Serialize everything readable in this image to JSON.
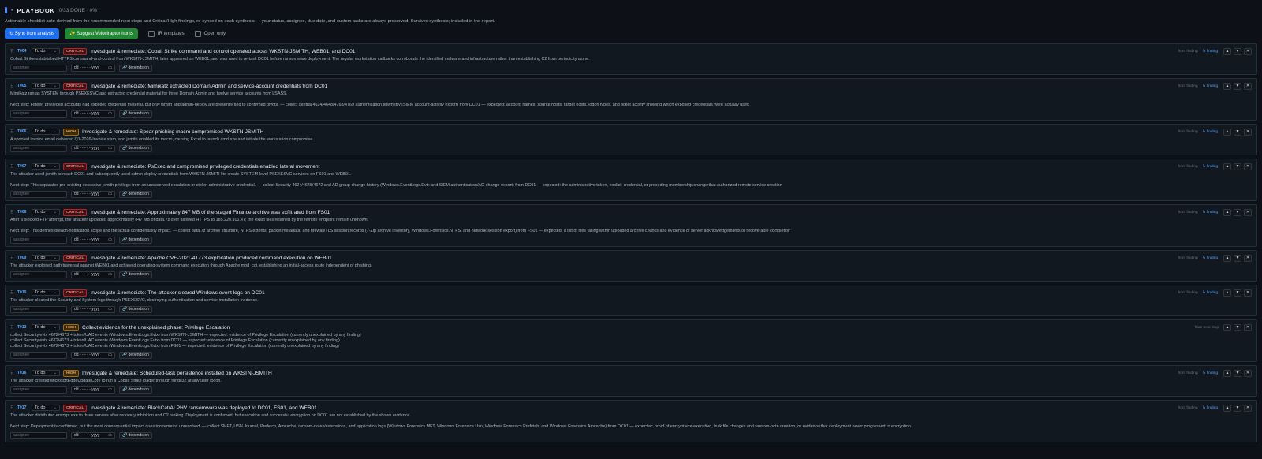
{
  "header": {
    "title": "PLAYBOOK",
    "count": "0/33 DONE · 0%"
  },
  "description": "Actionable checklist auto-derived from the recommended next steps and Critical/High findings, re-synced on each synthesis — your status, assignee, due date, and custom tasks are always preserved. Survives synthesis; included in the report.",
  "toolbar": {
    "sync_label": "↻ Sync from analysis",
    "suggest_label": "✨ Suggest Velociraptor hunts",
    "ir_templates_label": "IR templates",
    "open_only_label": "Open only"
  },
  "common": {
    "assignee_placeholder": "assignee",
    "date_placeholder": "dd - - - - - yyyy",
    "depends_label": "🔗 depends on",
    "finding_link": "↳ finding",
    "up": "▲",
    "down": "▼",
    "close": "✕"
  },
  "tasks": [
    {
      "id": "T004",
      "status": "To do",
      "severity": "CRITICAL",
      "title": "Investigate & remediate: Cobalt Strike command and control operated across WKSTN-JSMITH, WEB01, and DC01",
      "source": "from finding",
      "has_link": true,
      "body": "Cobalt Strike established HTTPS command-and-control from WKSTN-JSMITH, later appeared on WEB01, and was used to re-task DC01 before ransomware deployment. The regular workstation callbacks corroborate the identified malware and infrastructure rather than establishing C2 from periodicity alone.",
      "next": ""
    },
    {
      "id": "T005",
      "status": "To do",
      "severity": "CRITICAL",
      "title": "Investigate & remediate: Mimikatz extracted Domain Admin and service-account credentials from DC01",
      "source": "from finding",
      "has_link": true,
      "body": "Mimikatz ran as SYSTEM through PSEXESVC and extracted credential material for three Domain Admin and twelve service accounts from LSASS.",
      "next": "Next step: Fifteen privileged accounts had exposed credential material, but only jsmith and admin-deploy are presently tied to confirmed pivots. — collect central 4624/4648/4768/4769 authentication telemetry (SIEM account-activity export) from DC01 — expected: account names, source hosts, target hosts, logon types, and ticket activity showing which exposed credentials were actually used"
    },
    {
      "id": "T006",
      "status": "To do",
      "severity": "HIGH",
      "title": "Investigate & remediate: Spear-phishing macro compromised WKSTN-JSMITH",
      "source": "from finding",
      "has_link": true,
      "body": "A spoofed invoice email delivered Q1-2026-Invoice.xlsm, and jsmith enabled its macro, causing Excel to launch cmd.exe and initiate the workstation compromise.",
      "next": ""
    },
    {
      "id": "T007",
      "status": "To do",
      "severity": "CRITICAL",
      "title": "Investigate & remediate: PsExec and compromised privileged credentials enabled lateral movement",
      "source": "from finding",
      "has_link": true,
      "body": "The attacker used jsmith to reach DC01 and subsequently used admin-deploy credentials from WKSTN-JSMITH to create SYSTEM-level PSEXESVC services on FS01 and WEB01.",
      "next": "Next step: This separates pre-existing excessive jsmith privilege from an unobserved escalation or stolen administrative credential. — collect Security 4624/4648/4672 and AD group-change history (Windows.EventLogs.Evtx and SIEM authentication/AD-change export) from DC01 — expected: the administrative token, explicit credential, or preceding membership change that authorized remote service creation"
    },
    {
      "id": "T008",
      "status": "To do",
      "severity": "CRITICAL",
      "title": "Investigate & remediate: Approximately 847 MB of the staged Finance archive was exfiltrated from FS01",
      "source": "from finding",
      "has_link": true,
      "body": "After a blocked FTP attempt, the attacker uploaded approximately 847 MB of data.7z over allowed HTTPS to 185.220.101.47; the exact files retained by the remote endpoint remain unknown.",
      "next": "Next step: This defines breach-notification scope and the actual confidentiality impact. — collect data.7z archive structure, NTFS extents, packet metadata, and firewall/TLS session records (7-Zip archive inventory, Windows.Forensics.NTFS, and network-session export) from FS01 — expected: a list of files falling within uploaded archive chunks and evidence of server acknowledgements or recoverable completion"
    },
    {
      "id": "T009",
      "status": "To do",
      "severity": "CRITICAL",
      "title": "Investigate & remediate: Apache CVE-2021-41773 exploitation produced command execution on WEB01",
      "source": "from finding",
      "has_link": true,
      "body": "The attacker exploited path traversal against WEB01 and achieved operating-system command execution through Apache mod_cgi, establishing an initial-access route independent of phishing.",
      "next": ""
    },
    {
      "id": "T010",
      "status": "To do",
      "severity": "CRITICAL",
      "title": "Investigate & remediate: The attacker cleared Windows event logs on DC01",
      "source": "from finding",
      "has_link": true,
      "body": "The attacker cleared the Security and System logs through PSEXESVC, destroying authentication and service-installation evidence.",
      "next": ""
    },
    {
      "id": "T013",
      "status": "To do",
      "severity": "HIGH",
      "title": "Collect evidence for the unexplained phase: Privilege Escalation",
      "source": "from next step",
      "has_link": false,
      "body": "collect Security.evtx 4672/4673 + token/UAC events (Windows.EventLogs.Evtx) from WKSTN-JSMITH — expected: evidence of Privilege Escalation (currently unexplained by any finding)\ncollect Security.evtx 4672/4673 + token/UAC events (Windows.EventLogs.Evtx) from DC01 — expected: evidence of Privilege Escalation (currently unexplained by any finding)\ncollect Security.evtx 4672/4673 + token/UAC events (Windows.EventLogs.Evtx) from FS01 — expected: evidence of Privilege Escalation (currently unexplained by any finding)",
      "next": ""
    },
    {
      "id": "T016",
      "status": "To do",
      "severity": "HIGH",
      "title": "Investigate & remediate: Scheduled-task persistence installed on WKSTN-JSMITH",
      "source": "from finding",
      "has_link": true,
      "body": "The attacker created MicrosoftEdgeUpdateCore to run a Cobalt Strike loader through rundll32 at any user logon.",
      "next": ""
    },
    {
      "id": "T017",
      "status": "To do",
      "severity": "CRITICAL",
      "title": "Investigate & remediate: BlackCat/ALPHV ransomware was deployed to DC01, FS01, and WEB01",
      "source": "from finding",
      "has_link": true,
      "body": "The attacker distributed encrypt.exe to three servers after recovery inhibition and C2 tasking. Deployment is confirmed, but execution and successful encryption on DC01 are not established by the shown evidence.",
      "next": "Next step: Deployment is confirmed, but the most consequential impact question remains unresolved. — collect $MFT, USN Journal, Prefetch, Amcache, ransom-notes/extensions, and application logs (Windows.Forensics.MFT, Windows.Forensics.Usn, Windows.Forensics.Prefetch, and Windows.Forensics.Amcache) from DC01 — expected: proof of encrypt.exe execution, bulk file changes and ransom-note creation, or evidence that deployment never progressed to encryption"
    }
  ]
}
